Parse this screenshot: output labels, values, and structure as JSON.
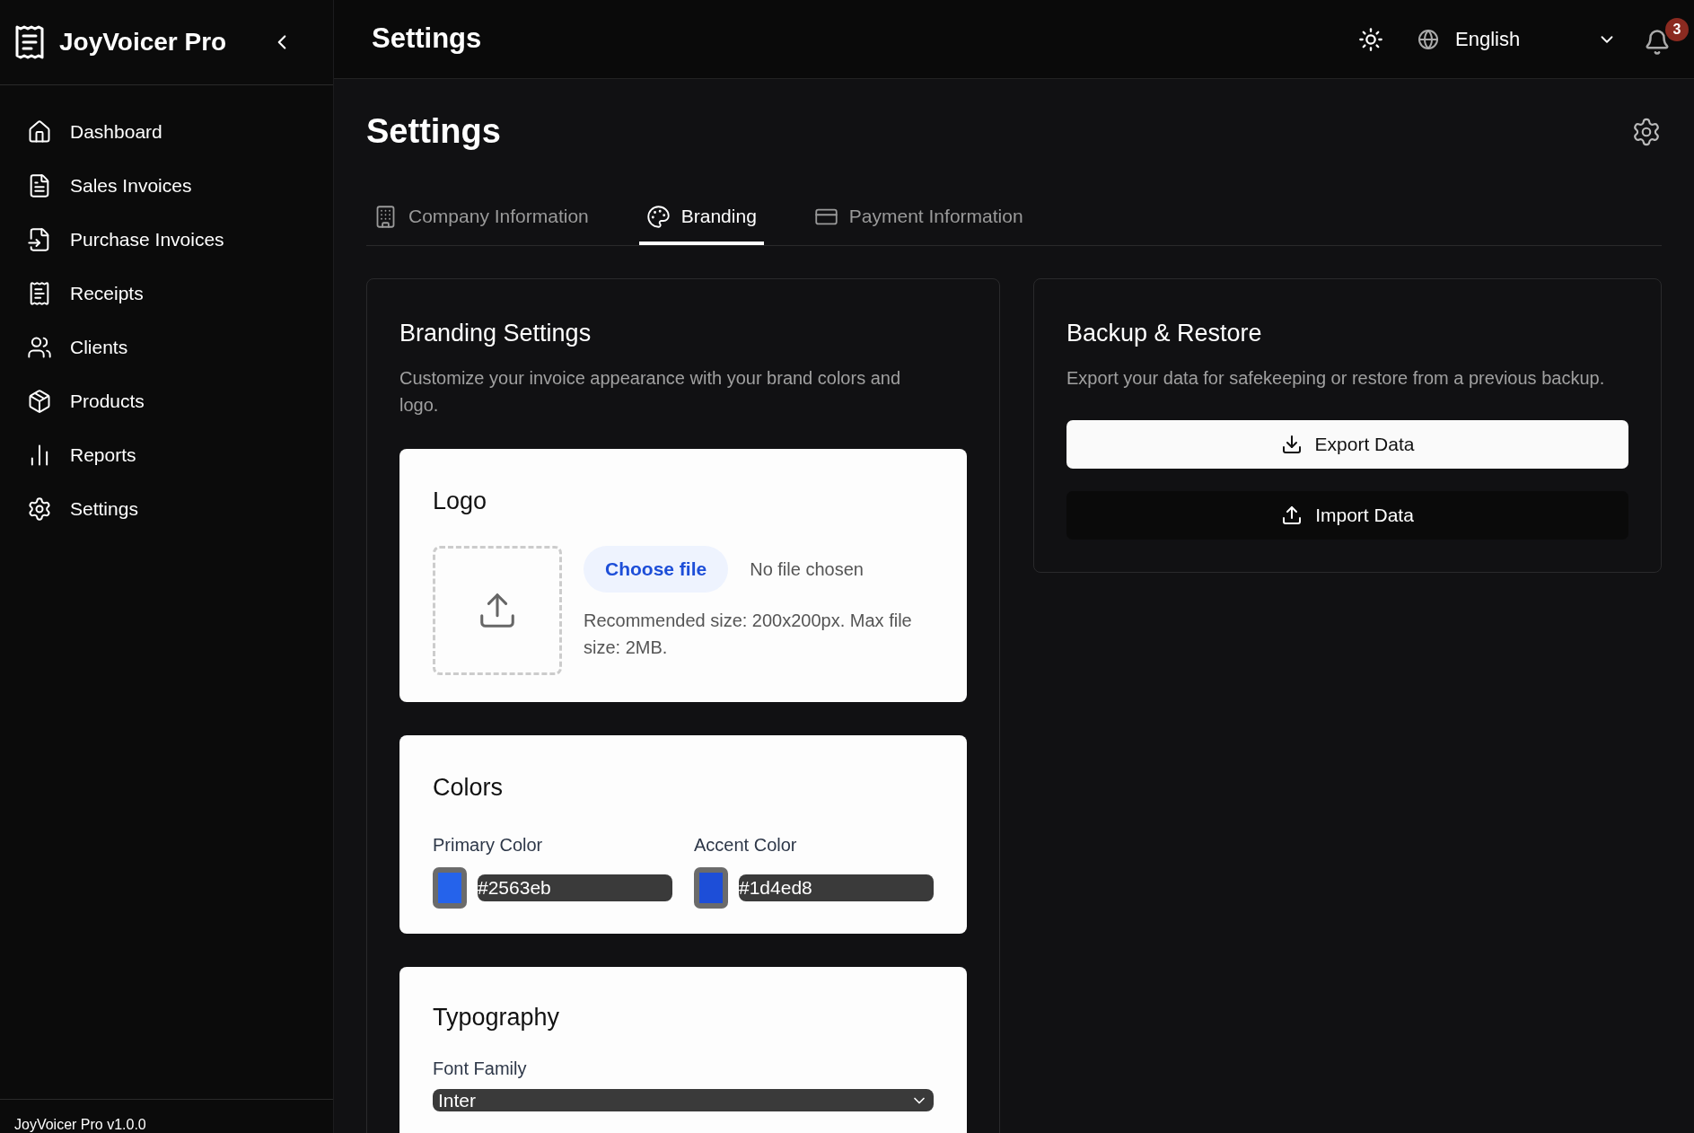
{
  "app": {
    "name": "JoyVoicer Pro",
    "version": "JoyVoicer Pro v1.0.0"
  },
  "sidebar": {
    "items": [
      {
        "label": "Dashboard"
      },
      {
        "label": "Sales Invoices"
      },
      {
        "label": "Purchase Invoices"
      },
      {
        "label": "Receipts"
      },
      {
        "label": "Clients"
      },
      {
        "label": "Products"
      },
      {
        "label": "Reports"
      },
      {
        "label": "Settings"
      }
    ]
  },
  "topbar": {
    "title": "Settings",
    "language": "English",
    "notification_count": "3"
  },
  "page": {
    "title": "Settings"
  },
  "tabs": [
    {
      "label": "Company Information",
      "selected": false
    },
    {
      "label": "Branding",
      "selected": true
    },
    {
      "label": "Payment Information",
      "selected": false
    }
  ],
  "branding": {
    "title": "Branding Settings",
    "description": "Customize your invoice appearance with your brand colors and logo.",
    "logo": {
      "title": "Logo",
      "button": "Choose file",
      "status": "No file chosen",
      "hint": "Recommended size: 200x200px. Max file size: 2MB."
    },
    "colors": {
      "title": "Colors",
      "items": [
        {
          "label": "Primary Color",
          "value": "#2563eb",
          "color": "#2563eb"
        },
        {
          "label": "Accent Color",
          "value": "#1d4ed8",
          "color": "#1d4ed8"
        }
      ]
    },
    "typography": {
      "title": "Typography",
      "font_label": "Font Family",
      "font_value": "Inter"
    }
  },
  "backup": {
    "title": "Backup & Restore",
    "description": "Export your data for safekeeping or restore from a previous backup.",
    "buttons": [
      {
        "label": "Export Data",
        "kind": "export"
      },
      {
        "label": "Import Data",
        "kind": "import"
      }
    ]
  }
}
